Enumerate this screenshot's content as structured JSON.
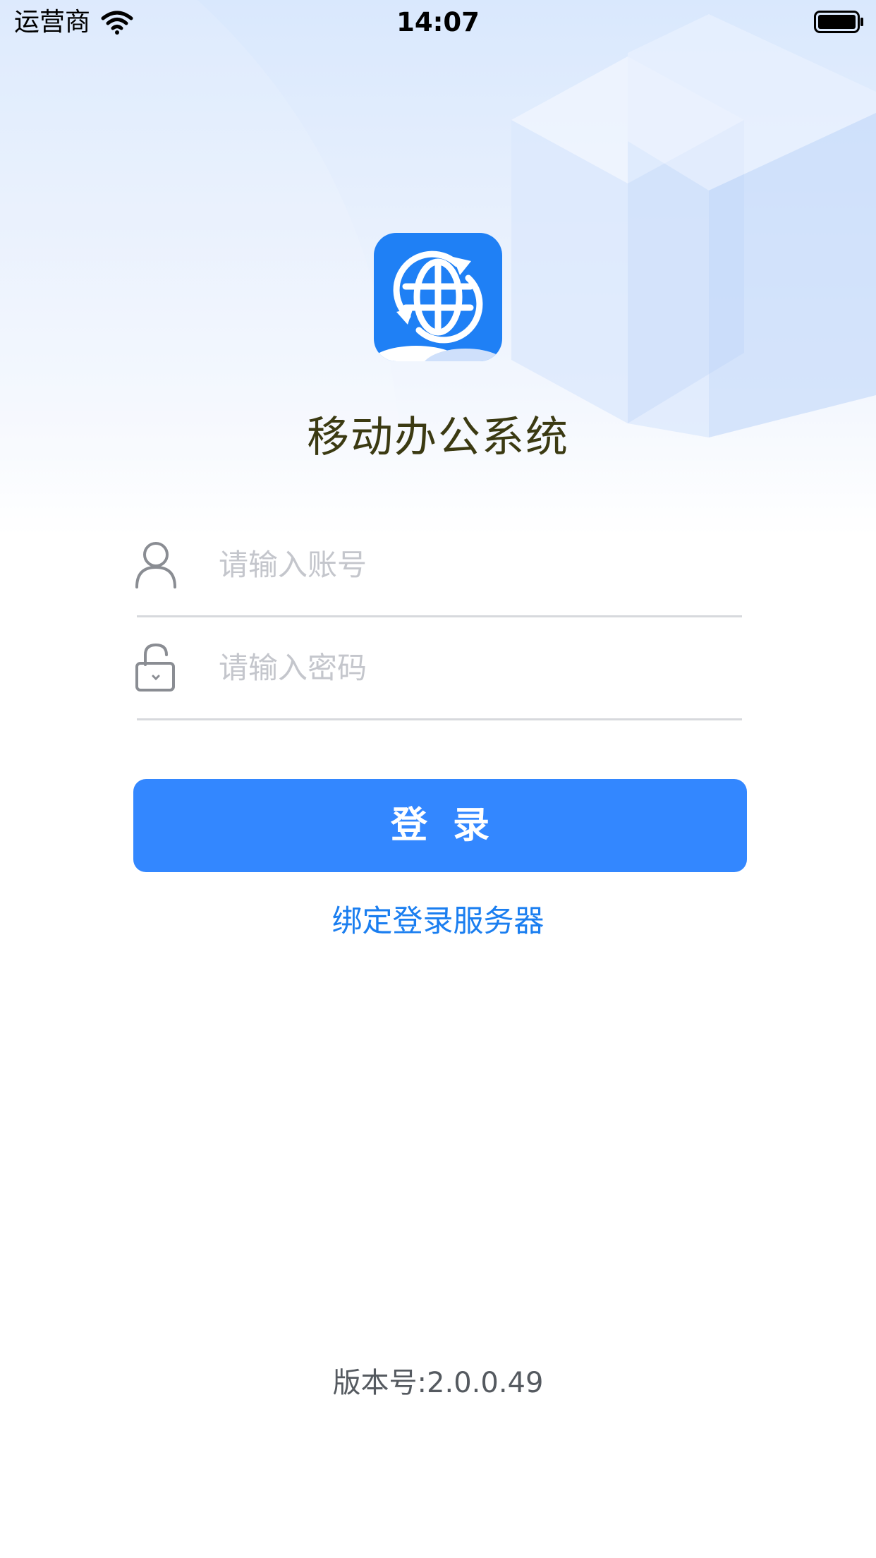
{
  "status_bar": {
    "carrier": "运营商",
    "time": "14:07",
    "wifi_icon": "wifi-icon",
    "battery_icon": "battery-icon"
  },
  "app": {
    "logo_icon": "globe-sync-icon",
    "title": "移动办公系统"
  },
  "login_form": {
    "account": {
      "icon": "user-icon",
      "placeholder": "请输入账号",
      "value": ""
    },
    "password": {
      "icon": "lock-icon",
      "placeholder": "请输入密码",
      "value": ""
    },
    "submit_label": "登录",
    "bind_server_label": "绑定登录服务器"
  },
  "footer": {
    "version": "版本号:2.0.0.49"
  },
  "colors": {
    "primary": "#3387ff",
    "link": "#1a7ef0",
    "title": "#3b3a12"
  }
}
